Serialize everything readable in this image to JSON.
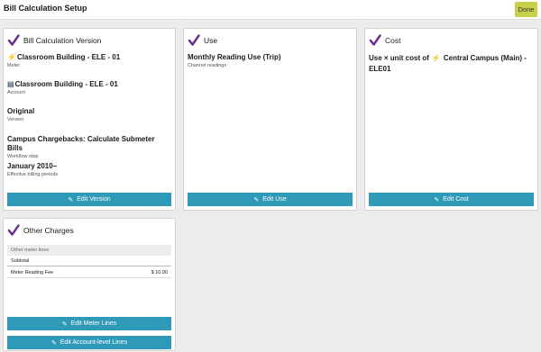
{
  "header": {
    "title": "Bill Calculation Setup",
    "done_label": "Done"
  },
  "version_card": {
    "title": "Bill Calculation Version",
    "meter": {
      "name": "Classroom Building - ELE - 01",
      "label": "Meter",
      "icon": "electric-bolt-icon"
    },
    "account": {
      "name": "Classroom Building - ELE - 01",
      "label": "Account",
      "icon": "account-book-icon"
    },
    "version": {
      "name": "Original",
      "label": "Version"
    },
    "workflow": {
      "name": "Campus Chargebacks: Calculate Submeter Bills",
      "label": "Workflow step"
    },
    "periods": {
      "name": "January 2010–",
      "label": "Effective billing periods"
    },
    "button_label": "Edit Version"
  },
  "use_card": {
    "title": "Use",
    "name": "Monthly Reading Use (Trip)",
    "label": "Channel readings",
    "button_label": "Edit Use"
  },
  "cost_card": {
    "title": "Cost",
    "prefix": "Use × unit cost of",
    "meter_name": "Central Campus (Main) -",
    "meter_suffix": "ELE01",
    "icon": "electric-bolt-icon",
    "button_label": "Edit Cost"
  },
  "other_card": {
    "title": "Other Charges",
    "table_header": "Other meter lines",
    "subtotal_label": "Subtotal",
    "lines": [
      {
        "name": "Meter Reading Fee",
        "amount": "$ 10.00"
      }
    ],
    "meter_lines_button": "Edit Meter Lines",
    "account_lines_button": "Edit Account-level Lines"
  },
  "colors": {
    "accent_check": "#6a2a8e",
    "button": "#2f99b8",
    "done": "#c8cf4a"
  }
}
